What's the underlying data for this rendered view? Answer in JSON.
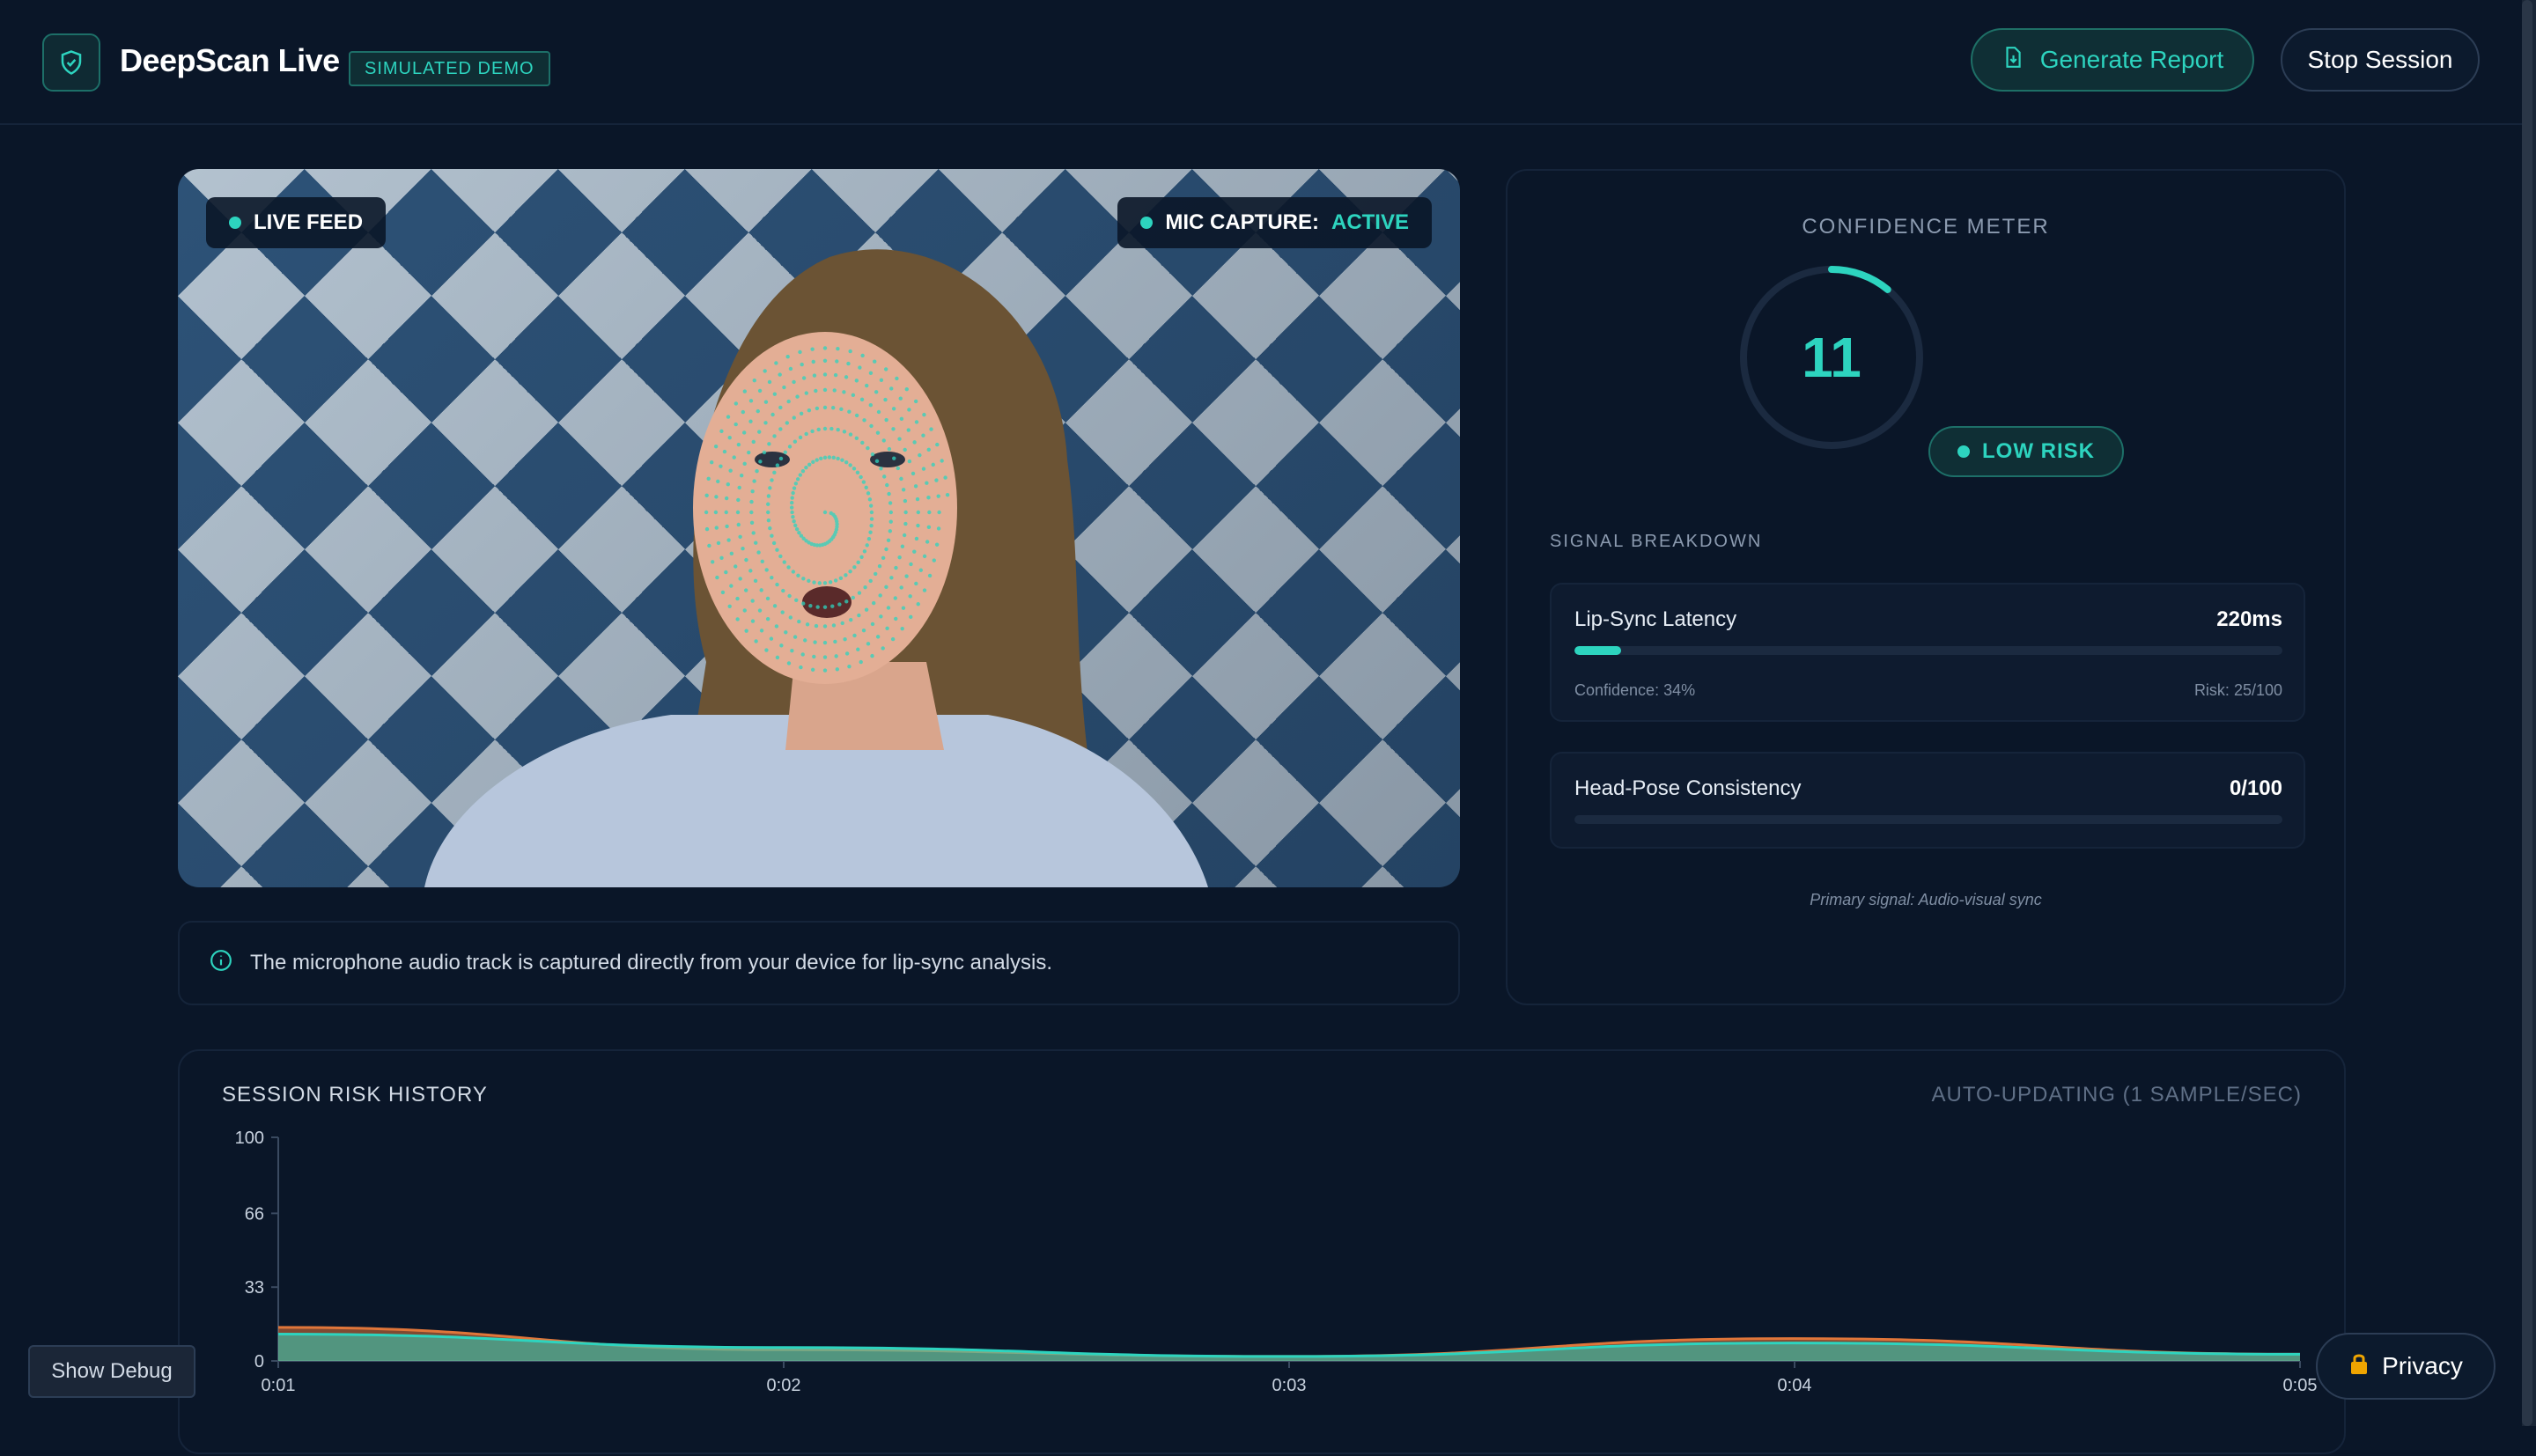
{
  "header": {
    "app_title": "DeepScan Live",
    "badge": "SIMULATED DEMO",
    "generate_report": "Generate Report",
    "stop_session": "Stop Session"
  },
  "video": {
    "live_label": "LIVE FEED",
    "mic_label": "MIC CAPTURE:",
    "mic_status": "ACTIVE"
  },
  "info": {
    "text": "The microphone audio track is captured directly from your device for lip-sync analysis."
  },
  "confidence": {
    "title": "CONFIDENCE METER",
    "value": "11",
    "risk_label": "LOW RISK",
    "signal_title": "SIGNAL BREAKDOWN",
    "signals": [
      {
        "name": "Lip-Sync Latency",
        "value": "220ms",
        "fill_fraction": 0.066,
        "confidence": "Confidence: 34%",
        "risk": "Risk: 25/100"
      },
      {
        "name": "Head-Pose Consistency",
        "value": "0/100",
        "fill_fraction": 0
      }
    ],
    "primary_note": "Primary signal: Audio-visual sync"
  },
  "history": {
    "title": "SESSION RISK HISTORY",
    "auto_label": "AUTO-UPDATING (1 SAMPLE/SEC)"
  },
  "footer": {
    "debug": "Show Debug",
    "privacy": "Privacy"
  },
  "colors": {
    "accent": "#2dd4bf",
    "background": "#0a1628"
  },
  "chart_data": {
    "type": "area",
    "x": [
      "0:01",
      "0:02",
      "0:03",
      "0:04",
      "0:05"
    ],
    "y_ticks": [
      0,
      33,
      66,
      100
    ],
    "ylim": [
      0,
      100
    ],
    "series": [
      {
        "values": [
          15,
          5,
          2,
          10,
          3
        ],
        "color": "#e0763a"
      },
      {
        "values": [
          12,
          6,
          2,
          8,
          3
        ],
        "color": "#2dd4bf"
      }
    ]
  }
}
